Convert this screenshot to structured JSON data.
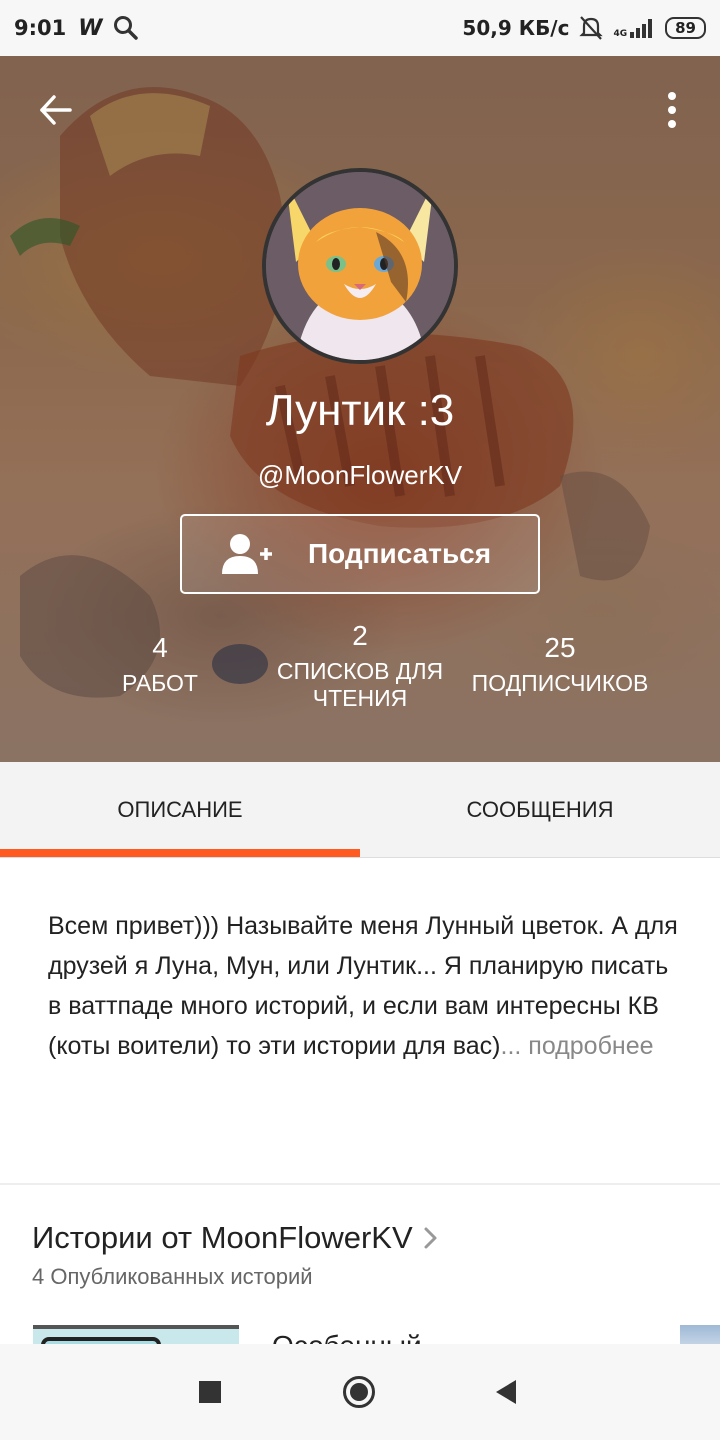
{
  "status_bar": {
    "time": "9:01",
    "app_icon": "W",
    "network_speed": "50,9 КБ/с",
    "network_type": "4G",
    "battery": "89",
    "icons": [
      "wattpad-icon",
      "search-icon",
      "bell-muted-icon",
      "signal-icon",
      "battery-icon"
    ]
  },
  "profile": {
    "display_name": "Лунтик :3",
    "username": "@MoonFlowerKV",
    "follow_label": "Подписаться",
    "stats": [
      {
        "value": "4",
        "label": "РАБОТ"
      },
      {
        "value": "2",
        "label": "СПИСКОВ ДЛЯ ЧТЕНИЯ"
      },
      {
        "value": "25",
        "label": "ПОДПИСЧИКОВ"
      }
    ]
  },
  "tabs": [
    {
      "label": "ОПИСАНИЕ",
      "active": true
    },
    {
      "label": "СООБЩЕНИЯ",
      "active": false
    }
  ],
  "accent_color": "#ff5a1f",
  "description": {
    "text": "Всем привет))) Называйте меня Лунный цветок. А для друзей я Луна, Мун, или Лунтик... Я планирую писать в ваттпаде много историй, и если вам интересны КВ (коты воители) то эти истории для вас)",
    "more": "... подробнее"
  },
  "stories": {
    "title": "Истории от MoonFlowerKV",
    "count": "4 Опубликованных историй",
    "first_story_title": "Особенный"
  }
}
